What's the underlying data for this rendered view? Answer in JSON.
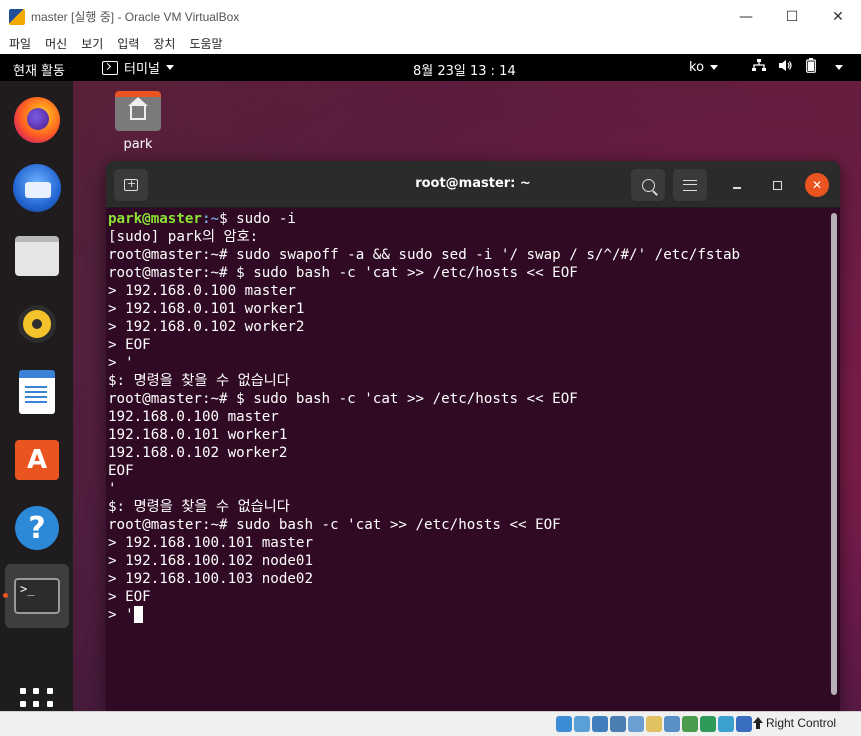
{
  "vbox": {
    "title": "master [실행 중] - Oracle VM VirtualBox",
    "menu": [
      "파일",
      "머신",
      "보기",
      "입력",
      "장치",
      "도움말"
    ],
    "status": {
      "host_key": "Right Control"
    }
  },
  "topbar": {
    "activities": "현재 활동",
    "app_name": "터미널",
    "clock": "8월 23일  13 : 14",
    "keyboard": "ko"
  },
  "dock": {
    "items": [
      {
        "name": "firefox-icon"
      },
      {
        "name": "thunderbird-icon"
      },
      {
        "name": "files-icon"
      },
      {
        "name": "rhythmbox-icon"
      },
      {
        "name": "libreoffice-writer-icon"
      },
      {
        "name": "software-store-icon"
      },
      {
        "name": "help-icon"
      },
      {
        "name": "terminal-icon",
        "active": true
      }
    ]
  },
  "desktop": {
    "folder_label": "park"
  },
  "terminal": {
    "title": "root@master: ~",
    "lines": [
      {
        "user": "park@master",
        "path": ":~",
        "rest": "$ sudo -i"
      },
      {
        "text": "[sudo] park의 암호:"
      },
      {
        "text": "root@master:~# sudo swapoff -a && sudo sed -i '/ swap / s/^/#/' /etc/fstab"
      },
      {
        "text": "root@master:~# $ sudo bash -c 'cat >> /etc/hosts << EOF"
      },
      {
        "text": "> 192.168.0.100 master"
      },
      {
        "text": "> 192.168.0.101 worker1"
      },
      {
        "text": "> 192.168.0.102 worker2"
      },
      {
        "text": "> EOF"
      },
      {
        "text": "> '"
      },
      {
        "text": "$: 명령을 찾을 수 없습니다"
      },
      {
        "text": "root@master:~# $ sudo bash -c 'cat >> /etc/hosts << EOF"
      },
      {
        "text": "192.168.0.100 master"
      },
      {
        "text": "192.168.0.101 worker1"
      },
      {
        "text": "192.168.0.102 worker2"
      },
      {
        "text": "EOF"
      },
      {
        "text": "'"
      },
      {
        "text": "$: 명령을 찾을 수 없습니다"
      },
      {
        "text": "root@master:~# sudo bash -c 'cat >> /etc/hosts << EOF"
      },
      {
        "text": "> 192.168.100.101 master"
      },
      {
        "text": "> 192.168.100.102 node01"
      },
      {
        "text": "> 192.168.100.103 node02"
      },
      {
        "text": "> EOF"
      },
      {
        "text": "> '",
        "cursor": true
      }
    ]
  },
  "colors": {
    "terminal_bg": "#300a24",
    "prompt_user": "#8ae234",
    "prompt_path": "#729fcf",
    "ubuntu_orange": "#e95420"
  }
}
